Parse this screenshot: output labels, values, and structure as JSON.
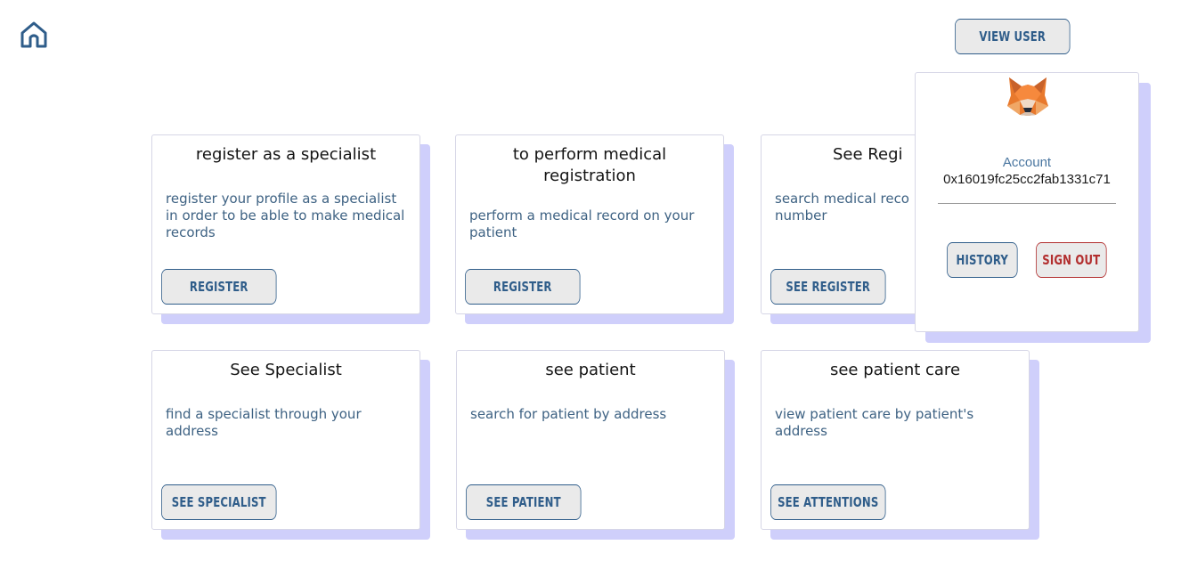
{
  "header": {
    "home_icon": "home-icon",
    "view_user_label": "VIEW USER"
  },
  "cards": [
    {
      "title": "register as a specialist",
      "description": "register your profile as a specialist in order to be able to make medical records",
      "button_label": "REGISTER"
    },
    {
      "title": "to perform medical registration",
      "description": "perform a medical record on your patient",
      "button_label": "REGISTER"
    },
    {
      "title": "See Regi",
      "description": "search medical reco number",
      "button_label": "SEE REGISTER"
    },
    {
      "title": "See Specialist",
      "description": "find a specialist through your address",
      "button_label": "SEE SPECIALIST"
    },
    {
      "title": "see patient",
      "description": "search for patient by address",
      "button_label": "SEE PATIENT"
    },
    {
      "title": "see patient care",
      "description": "view patient care by patient's address",
      "button_label": "SEE ATTENTIONS"
    }
  ],
  "account_panel": {
    "avatar_icon": "fox-icon",
    "label": "Account",
    "address": "0x16019fc25cc2fab1331c71",
    "history_label": "HISTORY",
    "sign_out_label": "SIGN OUT"
  },
  "colors": {
    "primary": "#2f5d8a",
    "button_bg": "#eaeaea",
    "card_shadow": "#cfcffb",
    "danger": "#b22e2e",
    "description_text": "#3e6283"
  }
}
